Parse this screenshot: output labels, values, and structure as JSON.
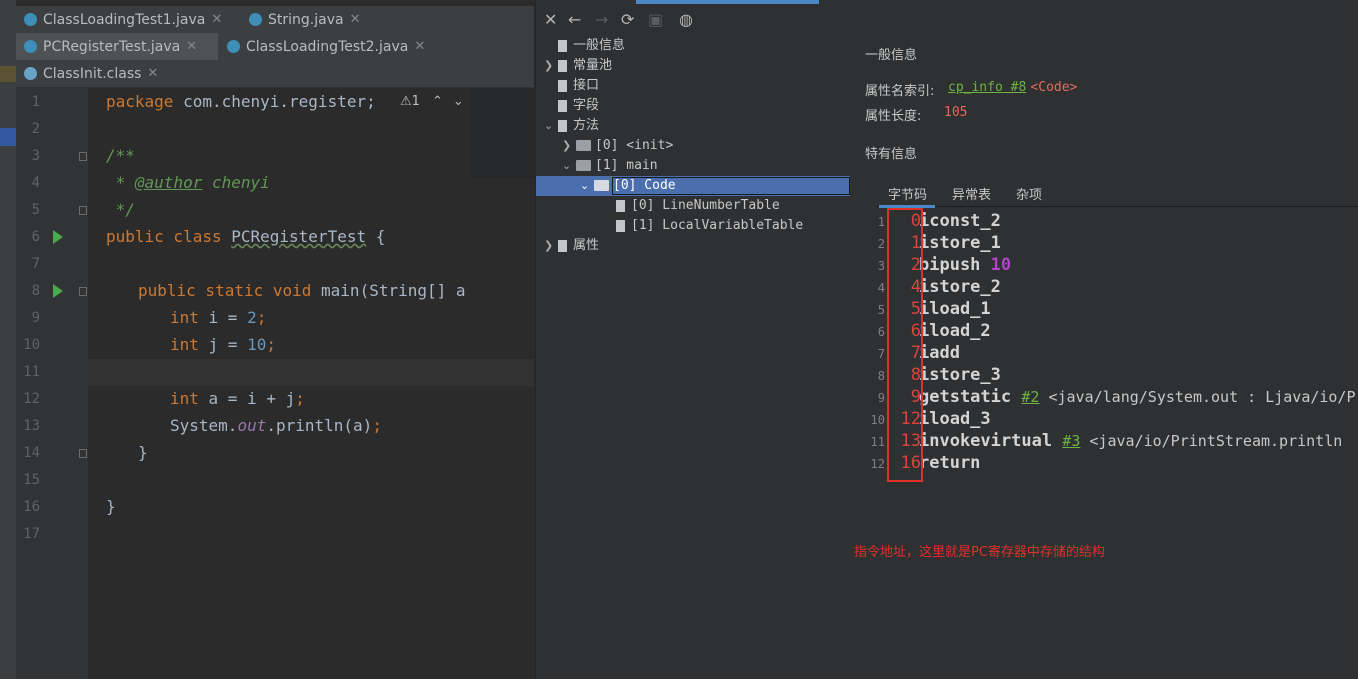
{
  "editor": {
    "tab_rows": [
      [
        {
          "label": "ClassLoadingTest1.java",
          "active": false
        },
        {
          "label": "String.java",
          "active": false
        }
      ],
      [
        {
          "label": "PCRegisterTest.java",
          "active": true
        },
        {
          "label": "ClassLoadingTest2.java",
          "active": false
        }
      ],
      [
        {
          "label": "ClassInit.class",
          "active": false
        }
      ]
    ],
    "warning_count": "⚠1",
    "line_numbers": [
      "1",
      "2",
      "3",
      "4",
      "5",
      "6",
      "7",
      "8",
      "9",
      "10",
      "11",
      "12",
      "13",
      "14",
      "15",
      "16",
      "17"
    ],
    "code": {
      "l1_kw": "package",
      "l1_rest": " com.chenyi.register;",
      "l3": "/**",
      "l4_star": " * ",
      "l4_tag": "@author",
      "l4_name": " chenyi",
      "l5": " */",
      "l6_kw": "public class ",
      "l6_name": "PCRegisterTest",
      "l6_brace": " {",
      "l8_kw": "public static void ",
      "l8_rest": "main(String[] a",
      "l9_kw": "int",
      "l9_mid": " i = ",
      "l9_num": "2",
      "l9_end": ";",
      "l10_kw": "int",
      "l10_mid": " j = ",
      "l10_num": "10",
      "l10_end": ";",
      "l12_kw": "int",
      "l12_rest": " a = i + j",
      "l12_end": ";",
      "l13_a": "System.",
      "l13_out": "out",
      "l13_b": ".println(a)",
      "l13_end": ";",
      "l14": "}",
      "l16": "}"
    }
  },
  "toolbar": {
    "close": "✕",
    "back": "←",
    "forward": "→",
    "refresh": "⟳",
    "save": "▣",
    "web": "◍"
  },
  "tree": {
    "general": "一般信息",
    "constant_pool": "常量池",
    "interfaces": "接口",
    "fields": "字段",
    "methods": "方法",
    "init": "[0] <init>",
    "main": "[1] main",
    "code": "[0] Code",
    "line_number_table": "[0] LineNumberTable",
    "local_variable_table": "[1] LocalVariableTable",
    "attributes": "属性"
  },
  "details": {
    "general_title": "一般信息",
    "name_index_label": "属性名索引:",
    "name_index_link": "cp_info #8",
    "name_index_value": "<Code>",
    "length_label": "属性长度:",
    "length_value": "105",
    "specific_title": "特有信息",
    "subtabs": [
      "字节码",
      "异常表",
      "杂项"
    ]
  },
  "bytecode": [
    {
      "line": "1",
      "pc": "0",
      "op": "iconst_2"
    },
    {
      "line": "2",
      "pc": "1",
      "op": "istore_1"
    },
    {
      "line": "3",
      "pc": "2",
      "op": "bipush ",
      "arg": "10"
    },
    {
      "line": "4",
      "pc": "4",
      "op": "istore_2"
    },
    {
      "line": "5",
      "pc": "5",
      "op": "iload_1"
    },
    {
      "line": "6",
      "pc": "6",
      "op": "iload_2"
    },
    {
      "line": "7",
      "pc": "7",
      "op": "iadd"
    },
    {
      "line": "8",
      "pc": "8",
      "op": "istore_3"
    },
    {
      "line": "9",
      "pc": "9",
      "op": "getstatic ",
      "ref": "#2",
      "comment": " <java/lang/System.out : Ljava/io/P"
    },
    {
      "line": "10",
      "pc": "12",
      "op": "iload_3"
    },
    {
      "line": "11",
      "pc": "13",
      "op": "invokevirtual ",
      "ref": "#3",
      "comment": " <java/io/PrintStream.println"
    },
    {
      "line": "12",
      "pc": "16",
      "op": "return"
    }
  ],
  "annotation": "指令地址，这里就是PC寄存器中存储的结构"
}
